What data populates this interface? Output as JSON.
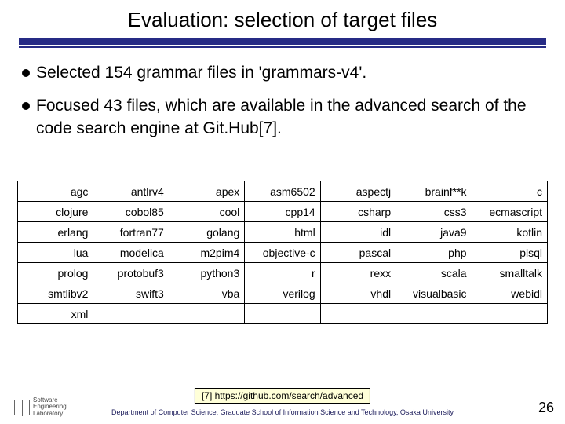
{
  "title": "Evaluation: selection of target files",
  "bullets": [
    "Selected 154 grammar files in 'grammars-v4'.",
    "Focused 43 files, which are available in the advanced search of the code search engine at Git.Hub[7]."
  ],
  "table": [
    [
      "agc",
      "antlrv4",
      "apex",
      "asm6502",
      "aspectj",
      "brainf**k",
      "c"
    ],
    [
      "clojure",
      "cobol85",
      "cool",
      "cpp14",
      "csharp",
      "css3",
      "ecmascript"
    ],
    [
      "erlang",
      "fortran77",
      "golang",
      "html",
      "idl",
      "java9",
      "kotlin"
    ],
    [
      "lua",
      "modelica",
      "m2pim4",
      "objective-c",
      "pascal",
      "php",
      "plsql"
    ],
    [
      "prolog",
      "protobuf3",
      "python3",
      "r",
      "rexx",
      "scala",
      "smalltalk"
    ],
    [
      "smtlibv2",
      "swift3",
      "vba",
      "verilog",
      "vhdl",
      "visualbasic",
      "webidl"
    ],
    [
      "xml",
      "",
      "",
      "",
      "",
      "",
      ""
    ]
  ],
  "reference": "[7] https://github.com/search/advanced",
  "affiliation": "Department of Computer Science, Graduate School of Information Science and Technology, Osaka University",
  "logo_text": "Software\nEngineering\nLaboratory",
  "page_number": "26"
}
